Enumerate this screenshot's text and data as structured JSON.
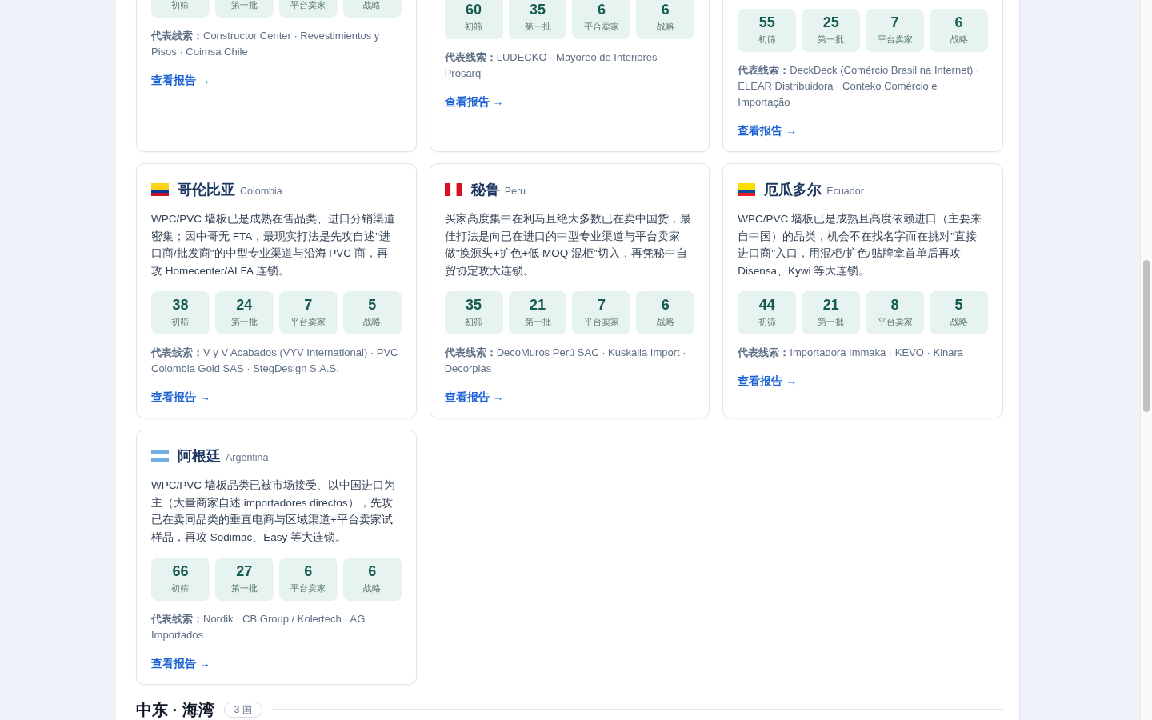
{
  "cards": [
    {
      "stats": [
        {
          "label": "初筛"
        },
        {
          "label": "第一批"
        },
        {
          "label": "平台卖家"
        },
        {
          "label": "战略"
        }
      ],
      "leads": "**代表线索：**Constructor Center · Revestimientos y Pisos · Coimsa Chile",
      "link": "查看报告 →"
    },
    {
      "stats": [
        {
          "value": "60",
          "label": "初筛"
        },
        {
          "value": "35",
          "label": "第一批"
        },
        {
          "value": "6",
          "label": "平台卖家"
        },
        {
          "value": "6",
          "label": "战略"
        }
      ],
      "leads": "**代表线索：**LUDECKO · Mayoreo de Interiores · Prosarq",
      "link": "查看报告 →"
    },
    {
      "stats": [
        {
          "value": "55",
          "label": "初筛"
        },
        {
          "value": "25",
          "label": "第一批"
        },
        {
          "value": "7",
          "label": "平台卖家"
        },
        {
          "value": "6",
          "label": "战略"
        }
      ],
      "leads": "**代表线索：**DeckDeck (Comércio Brasil na Internet) · ELEAR Distribuidora · Conteko Comércio e Importação",
      "link": "查看报告 →"
    },
    {
      "flag": {
        "kind": "wide-top",
        "stripes": [
          {
            "color": "#fcd116"
          },
          {
            "color": "#003893"
          },
          {
            "color": "#ce1126"
          }
        ]
      },
      "name": "哥伦比亚",
      "name_en": "Colombia",
      "summary": "WPC/PVC 墙板已是成熟在售品类、进口分销渠道密集；因中哥无 FTA，最现实打法是先攻自述\"进口商/批发商\"的中型专业渠道与沿海 PVC 商，再攻 Homecenter/ALFA 连锁。",
      "stats": [
        {
          "value": "38",
          "label": "初筛"
        },
        {
          "value": "24",
          "label": "第一批"
        },
        {
          "value": "7",
          "label": "平台卖家"
        },
        {
          "value": "5",
          "label": "战略"
        }
      ],
      "leads": "**代表线索：**V y V Acabados (VYV International) · PVC Colombia Gold SAS · StegDesign S.A.S.",
      "link": "查看报告 →"
    },
    {
      "flag": {
        "kind": "vertical",
        "stripes": [
          {
            "color": "#d91023"
          },
          {
            "color": "#ffffff"
          },
          {
            "color": "#d91023"
          }
        ]
      },
      "name": "秘鲁",
      "name_en": "Peru",
      "summary": "买家高度集中在利马且绝大多数已在卖中国货，最佳打法是向已在进口的中型专业渠道与平台卖家做\"换源头+扩色+低 MOQ 混柜\"切入，再凭秘中自贸协定攻大连锁。",
      "stats": [
        {
          "value": "35",
          "label": "初筛"
        },
        {
          "value": "21",
          "label": "第一批"
        },
        {
          "value": "7",
          "label": "平台卖家"
        },
        {
          "value": "6",
          "label": "战略"
        }
      ],
      "leads": "**代表线索：**DecoMuros Perú SAC · Kuskalla Import · Decorplas",
      "link": "查看报告 →"
    },
    {
      "flag": {
        "kind": "wide-top",
        "stripes": [
          {
            "color": "#ffdd00"
          },
          {
            "color": "#034ea2"
          },
          {
            "color": "#ed1c24"
          }
        ]
      },
      "name": "厄瓜多尔",
      "name_en": "Ecuador",
      "summary": "WPC/PVC 墙板已是成熟且高度依赖进口（主要来自中国）的品类，机会不在找名字而在挑对\"直接进口商\"入口，用混柜/扩色/贴牌拿首单后再攻 Disensa、Kywi 等大连锁。",
      "stats": [
        {
          "value": "44",
          "label": "初筛"
        },
        {
          "value": "21",
          "label": "第一批"
        },
        {
          "value": "8",
          "label": "平台卖家"
        },
        {
          "value": "5",
          "label": "战略"
        }
      ],
      "leads": "**代表线索：**Importadora Immaka · KEVO · Kinara",
      "link": "查看报告 →"
    },
    {
      "flag": {
        "kind": "horizontal",
        "stripes": [
          {
            "color": "#74acdf"
          },
          {
            "color": "#ffffff"
          },
          {
            "color": "#74acdf"
          }
        ]
      },
      "name": "阿根廷",
      "name_en": "Argentina",
      "summary": "WPC/PVC 墙板品类已被市场接受、以中国进口为主（大量商家自述 importadores directos），先攻已在卖同品类的垂直电商与区域渠道+平台卖家试样品，再攻 Sodimac、Easy 等大连锁。",
      "stats": [
        {
          "value": "66",
          "label": "初筛"
        },
        {
          "value": "27",
          "label": "第一批"
        },
        {
          "value": "6",
          "label": "平台卖家"
        },
        {
          "value": "6",
          "label": "战略"
        }
      ],
      "leads": "**代表线索：**Nordik · CB Group / Kolertech · AG Importados",
      "link": "查看报告 →"
    }
  ],
  "next_section": {
    "title": "中东 · 海湾",
    "badge": "3 国"
  }
}
